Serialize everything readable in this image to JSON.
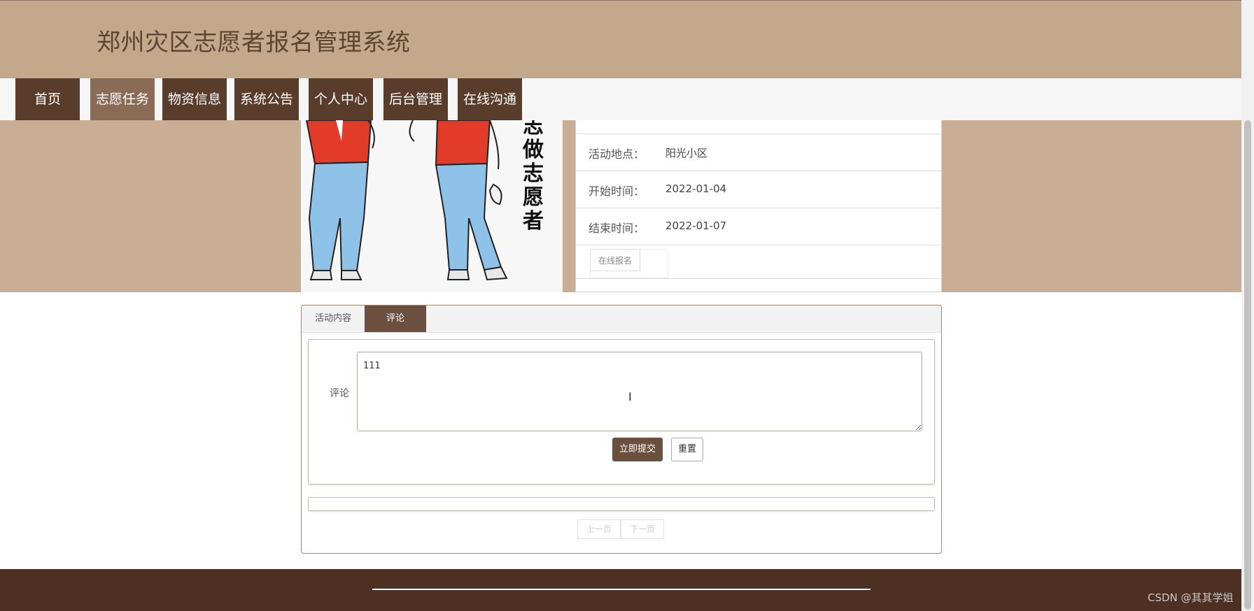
{
  "header": {
    "title": "郑州灾区志愿者报名管理系统"
  },
  "nav": {
    "items": [
      {
        "label": "首页"
      },
      {
        "label": "志愿任务"
      },
      {
        "label": "物资信息"
      },
      {
        "label": "系统公告"
      },
      {
        "label": "个人中心"
      },
      {
        "label": "后台管理"
      },
      {
        "label": "在线沟通"
      }
    ],
    "active_index": 1
  },
  "hero": {
    "image_text": "志做志愿者"
  },
  "details": {
    "rows": [
      {
        "label": "活动地点：",
        "value": "阳光小区"
      },
      {
        "label": "开始时间：",
        "value": "2022-01-04"
      },
      {
        "label": "结束时间：",
        "value": "2022-01-07"
      }
    ],
    "signup_label": "在线报名"
  },
  "tabs": [
    {
      "label": "活动内容"
    },
    {
      "label": "评论"
    }
  ],
  "comment_form": {
    "label": "评论",
    "value": "111",
    "submit_label": "立即提交",
    "reset_label": "重置"
  },
  "pagination": {
    "prev_label": "上一页",
    "next_label": "下一页"
  },
  "watermark": "CSDN @其其学姐",
  "colors": {
    "header_bg": "#c4a88b",
    "nav_item_bg": "#5a3c2b",
    "nav_active_bg": "#8a6b55",
    "hero_bg": "#c9ad94",
    "accent": "#6b5040",
    "footer_bg": "#4d3022"
  }
}
